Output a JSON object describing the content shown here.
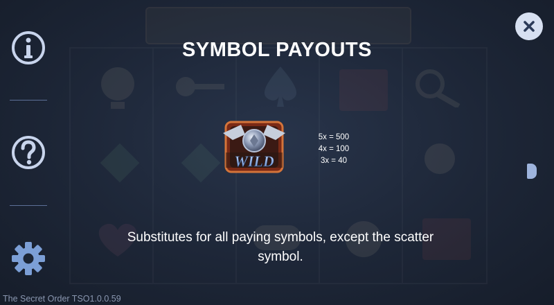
{
  "window": {
    "background_color": "#1c2535",
    "accent_color": "#d7e0f1"
  },
  "sidebar": {
    "items": [
      {
        "icon": "info-icon"
      },
      {
        "icon": "help-icon"
      },
      {
        "icon": "gear-icon"
      }
    ],
    "icon_color": "#c8d4ec"
  },
  "close_button": {
    "icon": "close-icon"
  },
  "payout_panel": {
    "title": "SYMBOL PAYOUTS",
    "symbol": {
      "icon": "wild-symbol-icon",
      "label": "WILD"
    },
    "payouts": [
      "5x = 500",
      "4x = 100",
      "3x = 40"
    ],
    "description": "Substitutes for all paying symbols, except the scatter symbol."
  },
  "right_handle": {
    "icon": "page-handle-icon"
  },
  "footer": {
    "version_text": "The Secret Order TSO1.0.0.59"
  }
}
